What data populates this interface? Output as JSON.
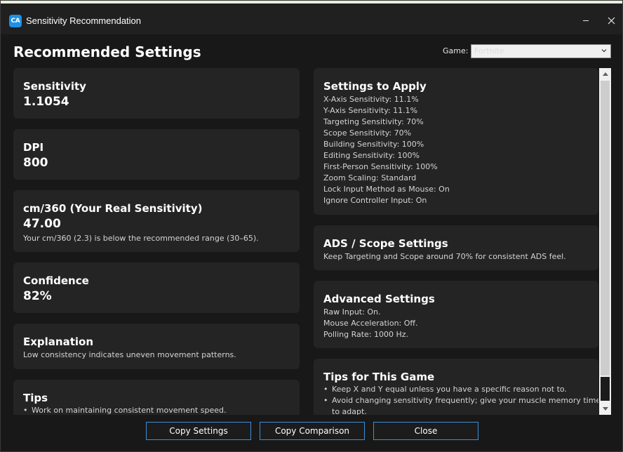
{
  "window": {
    "app_icon_text": "CA",
    "title": "Sensitivity Recommendation"
  },
  "header": {
    "title": "Recommended Settings",
    "game_label": "Game:",
    "game_value": "Fortnite"
  },
  "left": {
    "sensitivity": {
      "title": "Sensitivity",
      "value": "1.1054"
    },
    "dpi": {
      "title": "DPI",
      "value": "800"
    },
    "cm360": {
      "title": "cm/360 (Your Real Sensitivity)",
      "value": "47.00",
      "note": "Your cm/360 (2.3) is below the recommended range (30–65)."
    },
    "confidence": {
      "title": "Confidence",
      "value": "82%"
    },
    "explanation": {
      "title": "Explanation",
      "text": "Low consistency indicates uneven movement patterns."
    },
    "tips": {
      "title": "Tips",
      "items": [
        "Work on maintaining consistent movement speed."
      ]
    }
  },
  "right": {
    "settings_to_apply": {
      "title": "Settings to Apply",
      "lines": [
        "X-Axis Sensitivity: 11.1%",
        "Y-Axis Sensitivity: 11.1%",
        "Targeting Sensitivity: 70%",
        "Scope Sensitivity: 70%",
        "Building Sensitivity: 100%",
        "Editing Sensitivity: 100%",
        "First-Person Sensitivity: 100%",
        "Zoom Scaling: Standard",
        "Lock Input Method as Mouse: On",
        "Ignore Controller Input: On"
      ]
    },
    "ads": {
      "title": "ADS / Scope Settings",
      "text": "Keep Targeting and Scope around 70% for consistent ADS feel."
    },
    "advanced": {
      "title": "Advanced Settings",
      "lines": [
        "Raw Input: On.",
        "Mouse Acceleration: Off.",
        "Polling Rate: 1000 Hz."
      ]
    },
    "game_tips": {
      "title": "Tips for This Game",
      "items": [
        "Keep X and Y equal unless you have a specific reason not to.",
        "Avoid changing sensitivity frequently; give your muscle memory time",
        "to adapt."
      ]
    }
  },
  "buttons": {
    "copy_settings": "Copy Settings",
    "copy_comparison": "Copy Comparison",
    "close": "Close"
  },
  "colors": {
    "background": "#181818",
    "card": "#242424",
    "accent": "#3d8fd6",
    "app_icon": "#1e90e6"
  }
}
